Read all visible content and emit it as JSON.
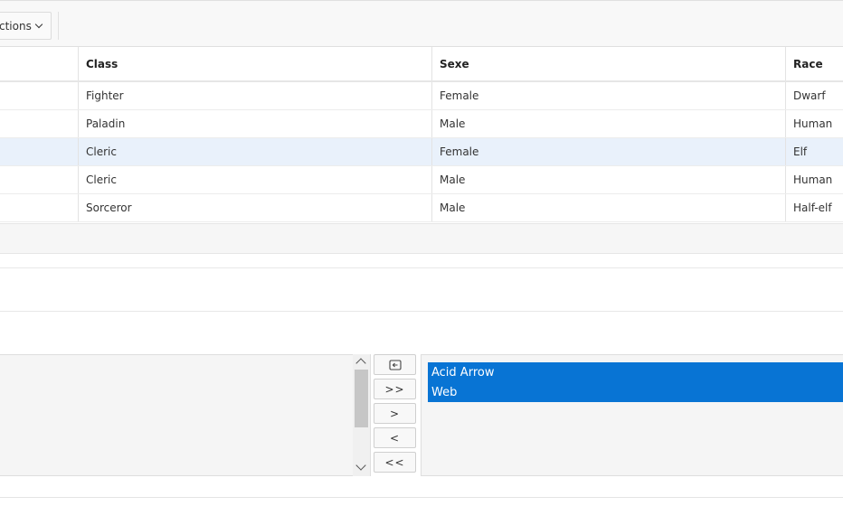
{
  "toolbar": {
    "actions_label": "ctions"
  },
  "grid": {
    "columns": [
      "",
      "Class",
      "Sexe",
      "Race"
    ],
    "rows": [
      {
        "name": "",
        "class": "Fighter",
        "sexe": "Female",
        "race": "Dwarf",
        "selected": false
      },
      {
        "name": "",
        "class": "Paladin",
        "sexe": "Male",
        "race": "Human",
        "selected": false
      },
      {
        "name": "",
        "class": "Cleric",
        "sexe": "Female",
        "race": "Elf",
        "selected": true
      },
      {
        "name": "",
        "class": "Cleric",
        "sexe": "Male",
        "race": "Human",
        "selected": false
      },
      {
        "name": "",
        "class": "Sorceror",
        "sexe": "Male",
        "race": "Half-elf",
        "selected": false
      }
    ]
  },
  "shuttle": {
    "buttons": {
      "reset": "reset-icon",
      "move_all": ">>",
      "move": ">",
      "remove": "<",
      "remove_all": "<<"
    },
    "selected_items": [
      "Acid Arrow",
      "Web"
    ]
  },
  "colors": {
    "selection": "#0874d4",
    "row_highlight": "#e9f1fb",
    "toolbar_bg": "#f8f8f8"
  }
}
